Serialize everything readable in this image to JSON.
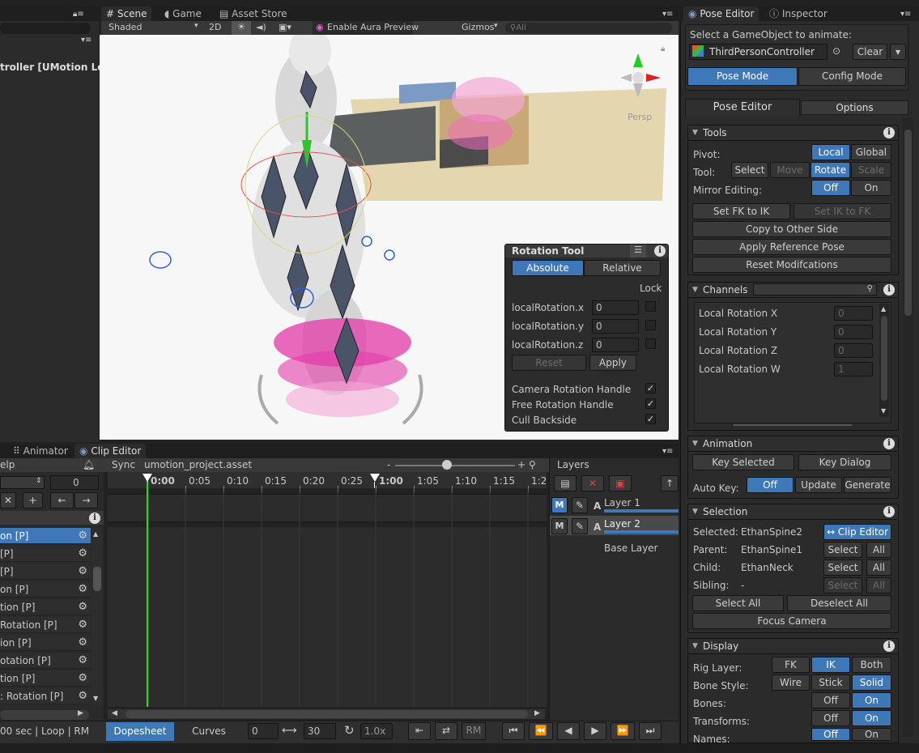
{
  "scene_tabs": [
    "Scene",
    "Game",
    "Asset Store"
  ],
  "scene_toolbar": {
    "shading": "Shaded",
    "mode_2d": "2D",
    "aura": "Enable Aura Preview",
    "gizmos": "Gizmos",
    "search_placeholder": "All"
  },
  "viewport": {
    "persp_label": "Persp"
  },
  "hierarchy": {
    "item": "troller [UMotion Lc"
  },
  "rotation_tool": {
    "title": "Rotation Tool",
    "absolute": "Absolute",
    "relative": "Relative",
    "lock": "Lock",
    "fields": [
      {
        "label": "localRotation.x",
        "value": "0"
      },
      {
        "label": "localRotation.y",
        "value": "0"
      },
      {
        "label": "localRotation.z",
        "value": "0"
      }
    ],
    "reset": "Reset",
    "apply": "Apply",
    "options": [
      {
        "label": "Camera Rotation Handle",
        "checked": "✓"
      },
      {
        "label": "Free Rotation Handle",
        "checked": "✓"
      },
      {
        "label": "Cull Backside",
        "checked": "✓"
      }
    ]
  },
  "bottom_tabs": [
    "Animator",
    "Clip Editor"
  ],
  "clip_editor": {
    "left_label": "elp",
    "frame_value": "0",
    "sync": "Sync",
    "project": "umotion_project.asset",
    "zoom_minus": "-",
    "zoom_plus": "+",
    "ticks": [
      "0:00",
      "0:05",
      "0:10",
      "0:15",
      "0:20",
      "0:25",
      "1:00",
      "1:05",
      "1:10",
      "1:15",
      "1:2"
    ],
    "channel_rows": [
      "on [P]",
      " [P]",
      " [P]",
      "on [P]",
      "tion [P]",
      "Rotation [P]",
      "ion [P]",
      "otation [P]",
      "tion [P]",
      " : Rotation [P]"
    ],
    "status": "00 sec | Loop | RM",
    "dopesheet": "Dopesheet",
    "curves": "Curves",
    "start_frame": "0",
    "end_frame": "30",
    "speed": "1.0x",
    "rm": "RM"
  },
  "layers": {
    "title": "Layers",
    "items": [
      {
        "m": "M",
        "a": "A",
        "name": "Layer 1"
      },
      {
        "m": "M",
        "a": "A",
        "name": "Layer 2"
      }
    ],
    "base": "Base Layer"
  },
  "right_tabs": [
    "Pose Editor",
    "Inspector"
  ],
  "pose_editor": {
    "select_label": "Select a GameObject to animate:",
    "object": "ThirdPersonController",
    "clear": "Clear",
    "pose_mode": "Pose Mode",
    "config_mode": "Config Mode",
    "tab_pose": "Pose Editor",
    "tab_options": "Options",
    "tools": {
      "title": "Tools",
      "pivot_label": "Pivot:",
      "pivot_local": "Local",
      "pivot_global": "Global",
      "tool_label": "Tool:",
      "tool_select": "Select",
      "tool_move": "Move",
      "tool_rotate": "Rotate",
      "tool_scale": "Scale",
      "mirror_label": "Mirror Editing:",
      "mirror_off": "Off",
      "mirror_on": "On",
      "fk_to_ik": "Set FK to IK",
      "ik_to_fk": "Set IK to FK",
      "copy_other": "Copy to Other Side",
      "apply_ref": "Apply Reference Pose",
      "reset_mod": "Reset Modifcations"
    },
    "channels": {
      "title": "Channels",
      "items": [
        {
          "label": "Local Rotation X",
          "value": "0"
        },
        {
          "label": "Local Rotation Y",
          "value": "0"
        },
        {
          "label": "Local Rotation Z",
          "value": "0"
        },
        {
          "label": "Local Rotation W",
          "value": "1"
        }
      ]
    },
    "animation": {
      "title": "Animation",
      "key_selected": "Key Selected",
      "key_dialog": "Key Dialog",
      "auto_key_label": "Auto Key:",
      "off": "Off",
      "update": "Update",
      "generate": "Generate"
    },
    "selection": {
      "title": "Selection",
      "selected_label": "Selected:",
      "selected_value": "EthanSpine2",
      "clip_editor": "↔ Clip Editor",
      "parent_label": "Parent:",
      "parent_value": "EthanSpine1",
      "child_label": "Child:",
      "child_value": "EthanNeck",
      "sibling_label": "Sibling:",
      "sibling_value": "-",
      "select": "Select",
      "all": "All",
      "select_all": "Select All",
      "deselect_all": "Deselect All",
      "focus_camera": "Focus Camera"
    },
    "display": {
      "title": "Display",
      "rig_layer_label": "Rig Layer:",
      "fk": "FK",
      "ik": "IK",
      "both": "Both",
      "bone_style_label": "Bone Style:",
      "wire": "Wire",
      "stick": "Stick",
      "solid": "Solid",
      "bones_label": "Bones:",
      "transforms_label": "Transforms:",
      "names_label": "Names:",
      "off": "Off",
      "on": "On"
    }
  },
  "colors": {
    "accent": "#3e78b8",
    "playhead": "#21e021",
    "background": "#222222"
  }
}
